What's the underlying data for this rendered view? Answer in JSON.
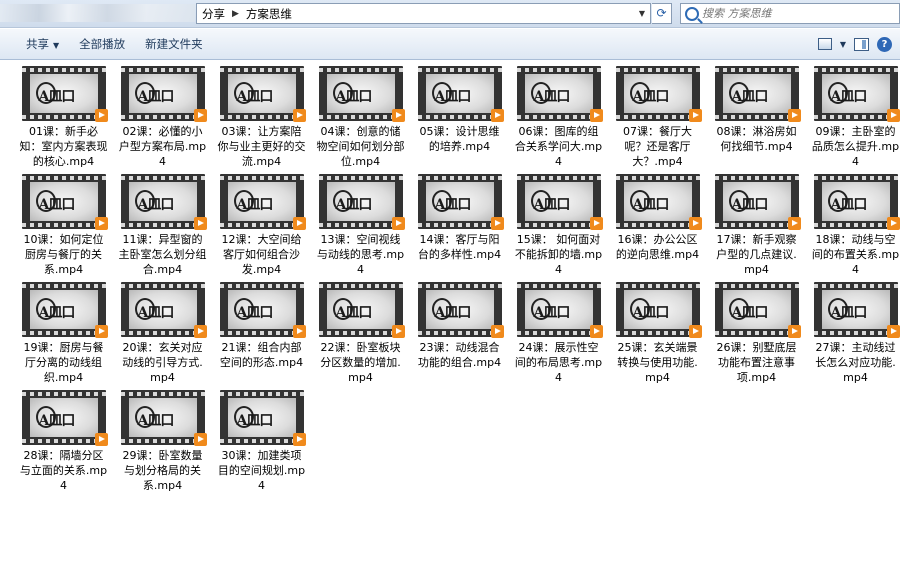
{
  "address_bar": {
    "breadcrumb": [
      "分享",
      "方案思维"
    ]
  },
  "search": {
    "placeholder": "搜索 方案思维"
  },
  "toolbar": {
    "share_label": "共享",
    "play_all_label": "全部播放",
    "new_folder_label": "新建文件夹"
  },
  "files": [
    "01课：新手必知：室内方案表现的核心.mp4",
    "02课：必懂的小户型方案布局.mp4",
    "03课：让方案陪你与业主更好的交流.mp4",
    "04课：创意的储物空间如何划分部位.mp4",
    "05课：设计思维的培养.mp4",
    "06课：图库的组合关系学问大.mp4",
    "07课：餐厅大呢？还是客厅大？.mp4",
    "08课：淋浴房如何找细节.mp4",
    "09课：主卧室的品质怎么提升.mp4",
    "10课：如何定位厨房与餐厅的关系.mp4",
    "11课：异型窗的主卧室怎么划分组合.mp4",
    "12课：大空间给客厅如何组合沙发.mp4",
    "13课：空间视线与动线的思考.mp4",
    "14课：客厅与阳台的多样性.mp4",
    "15课： 如何面对不能拆卸的墙.mp4",
    "16课：办公公区的逆向思维.mp4",
    "17课：新手观察户型的几点建议.mp4",
    "18课：动线与空间的布置关系.mp4",
    "19课：厨房与餐厅分离的动线组织.mp4",
    "20课：玄关对应动线的引导方式.mp4",
    "21课：组合内部空间的形态.mp4",
    "22课：卧室板块分区数量的增加.mp4",
    "23课：动线混合功能的组合.mp4",
    "24课：展示性空间的布局思考.mp4",
    "25课：玄关端景转换与使用功能.mp4",
    "26课：别墅底层功能布置注意事项.mp4",
    "27课：主动线过长怎么对应功能.mp4",
    "28课：隔墙分区与立面的关系.mp4",
    "29课：卧室数量与划分格局的关系.mp4",
    "30课：加建类项目的空间规划.mp4"
  ],
  "thumb_logo_text": "A皿口",
  "icons": {
    "view": "view-options-icon",
    "preview_pane": "preview-pane-icon",
    "help": "help-icon",
    "search": "search-icon",
    "refresh": "refresh-icon"
  }
}
